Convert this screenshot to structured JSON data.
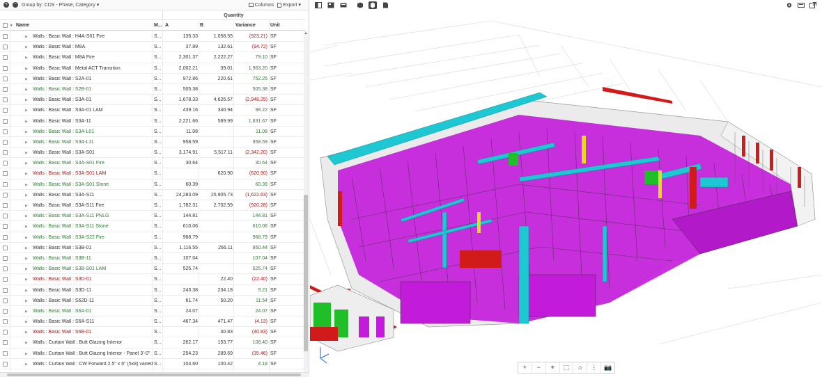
{
  "toolbar": {
    "group_by": "Group by: CDS - Phase, Category ▾",
    "columns": "Columns",
    "export": "Export ▾",
    "collapse_all": "+",
    "expand_all": "−"
  },
  "table": {
    "group_header": "Quantity",
    "headers": {
      "name": "Name",
      "m": "M...",
      "a": "A",
      "b": "B",
      "variance": "Variance",
      "unit": "Unit"
    },
    "rows": [
      {
        "name": "Walls : Basic Wall : H4A-S01 Fire",
        "m": "S...",
        "a": "135.33",
        "b": "1,058.55",
        "v": "(923.21)",
        "u": "SF",
        "nc": "c-black",
        "vc": "c-red"
      },
      {
        "name": "Walls : Basic Wall : M8A",
        "m": "S...",
        "a": "37.89",
        "b": "132.61",
        "v": "(94.72)",
        "u": "SF",
        "nc": "c-black",
        "vc": "c-red"
      },
      {
        "name": "Walls : Basic Wall : M8A Fire",
        "m": "S...",
        "a": "2,301.37",
        "b": "2,222.27",
        "v": "79.10",
        "u": "SF",
        "nc": "c-black",
        "vc": "c-green"
      },
      {
        "name": "Walls : Basic Wall : Metal ACT Transition",
        "m": "S...",
        "a": "2,002.21",
        "b": "39.01",
        "v": "1,963.20",
        "u": "SF",
        "nc": "c-black",
        "vc": "c-green"
      },
      {
        "name": "Walls : Basic Wall : S2A-01",
        "m": "S...",
        "a": "972.86",
        "b": "220.61",
        "v": "752.25",
        "u": "SF",
        "nc": "c-black",
        "vc": "c-green"
      },
      {
        "name": "Walls : Basic Wall : S2B-01",
        "m": "S...",
        "a": "505.38",
        "b": "",
        "v": "505.38",
        "u": "SF",
        "nc": "c-green",
        "vc": "c-green"
      },
      {
        "name": "Walls : Basic Wall : S3A-01",
        "m": "S...",
        "a": "1,678.33",
        "b": "4,626.57",
        "v": "(2,948.25)",
        "u": "SF",
        "nc": "c-black",
        "vc": "c-red"
      },
      {
        "name": "Walls : Basic Wall : S3A-01 LAM",
        "m": "S...",
        "a": "439.16",
        "b": "340.94",
        "v": "98.22",
        "u": "SF",
        "nc": "c-black",
        "vc": "c-green"
      },
      {
        "name": "Walls : Basic Wall : S3A-11",
        "m": "S...",
        "a": "2,221.66",
        "b": "589.99",
        "v": "1,631.67",
        "u": "SF",
        "nc": "c-black",
        "vc": "c-green"
      },
      {
        "name": "Walls : Basic Wall : S3A-L01",
        "m": "S...",
        "a": "11.08",
        "b": "",
        "v": "11.08",
        "u": "SF",
        "nc": "c-green",
        "vc": "c-green"
      },
      {
        "name": "Walls : Basic Wall : S3A-L11",
        "m": "S...",
        "a": "958.59",
        "b": "",
        "v": "958.59",
        "u": "SF",
        "nc": "c-green",
        "vc": "c-green"
      },
      {
        "name": "Walls : Basic Wall : S3A-S01",
        "m": "S...",
        "a": "3,174.91",
        "b": "5,517.11",
        "v": "(2,342.20)",
        "u": "SF",
        "nc": "c-black",
        "vc": "c-red"
      },
      {
        "name": "Walls : Basic Wall : S3A-S01 Fire",
        "m": "S...",
        "a": "30.64",
        "b": "",
        "v": "30.64",
        "u": "SF",
        "nc": "c-green",
        "vc": "c-green"
      },
      {
        "name": "Walls : Basic Wall : S3A-S01 LAM",
        "m": "S...",
        "a": "",
        "b": "620.90",
        "v": "(620.90)",
        "u": "SF",
        "nc": "c-red",
        "vc": "c-red"
      },
      {
        "name": "Walls : Basic Wall : S3A-S01 Stone",
        "m": "S...",
        "a": "60.39",
        "b": "",
        "v": "60.39",
        "u": "SF",
        "nc": "c-green",
        "vc": "c-green"
      },
      {
        "name": "Walls : Basic Wall : S3A-S11",
        "m": "S...",
        "a": "24,283.09",
        "b": "25,905.73",
        "v": "(1,622.63)",
        "u": "SF",
        "nc": "c-black",
        "vc": "c-red"
      },
      {
        "name": "Walls : Basic Wall : S3A-S11 Fire",
        "m": "S...",
        "a": "1,782.31",
        "b": "2,702.59",
        "v": "(920.28)",
        "u": "SF",
        "nc": "c-black",
        "vc": "c-red"
      },
      {
        "name": "Walls : Basic Wall : S3A-S11 PNLG",
        "m": "S...",
        "a": "144.81",
        "b": "",
        "v": "144.81",
        "u": "SF",
        "nc": "c-green",
        "vc": "c-green"
      },
      {
        "name": "Walls : Basic Wall : S3A-S11 Stone",
        "m": "S...",
        "a": "610.06",
        "b": "",
        "v": "610.06",
        "u": "SF",
        "nc": "c-green",
        "vc": "c-green"
      },
      {
        "name": "Walls : Basic Wall : S3A-S22 Fire",
        "m": "S...",
        "a": "968.79",
        "b": "",
        "v": "968.79",
        "u": "SF",
        "nc": "c-green",
        "vc": "c-green"
      },
      {
        "name": "Walls : Basic Wall : S3B-01",
        "m": "S...",
        "a": "1,116.55",
        "b": "266.11",
        "v": "850.44",
        "u": "SF",
        "nc": "c-black",
        "vc": "c-green"
      },
      {
        "name": "Walls : Basic Wall : S3B-11",
        "m": "S...",
        "a": "107.04",
        "b": "",
        "v": "107.04",
        "u": "SF",
        "nc": "c-green",
        "vc": "c-green"
      },
      {
        "name": "Walls : Basic Wall : S3B-S01 LAM",
        "m": "S...",
        "a": "525.74",
        "b": "",
        "v": "525.74",
        "u": "SF",
        "nc": "c-green",
        "vc": "c-green"
      },
      {
        "name": "Walls : Basic Wall : S3D-01",
        "m": "S...",
        "a": "",
        "b": "22.40",
        "v": "(22.40)",
        "u": "SF",
        "nc": "c-red",
        "vc": "c-red"
      },
      {
        "name": "Walls : Basic Wall : S3D-11",
        "m": "S...",
        "a": "243.38",
        "b": "234.18",
        "v": "9.21",
        "u": "SF",
        "nc": "c-black",
        "vc": "c-green"
      },
      {
        "name": "Walls : Basic Wall : S62D-11",
        "m": "S...",
        "a": "61.74",
        "b": "50.20",
        "v": "11.54",
        "u": "SF",
        "nc": "c-black",
        "vc": "c-green"
      },
      {
        "name": "Walls : Basic Wall : S6A-01",
        "m": "S...",
        "a": "24.07",
        "b": "",
        "v": "24.07",
        "u": "SF",
        "nc": "c-green",
        "vc": "c-green"
      },
      {
        "name": "Walls : Basic Wall : S6A-S11",
        "m": "S...",
        "a": "467.34",
        "b": "471.47",
        "v": "(4.13)",
        "u": "SF",
        "nc": "c-black",
        "vc": "c-red"
      },
      {
        "name": "Walls : Basic Wall : S6B-01",
        "m": "S...",
        "a": "",
        "b": "40.83",
        "v": "(40.83)",
        "u": "SF",
        "nc": "c-red",
        "vc": "c-red"
      },
      {
        "name": "Walls : Curtain Wall : Butt Glazing Interior",
        "m": "S...",
        "a": "262.17",
        "b": "153.77",
        "v": "108.40",
        "u": "SF",
        "nc": "c-black",
        "vc": "c-green"
      },
      {
        "name": "Walls : Curtain Wall : Butt Glazing Interior - Panel 3'-0\"",
        "m": "S...",
        "a": "254.23",
        "b": "289.69",
        "v": "(35.46)",
        "u": "SF",
        "nc": "c-black",
        "vc": "c-red"
      },
      {
        "name": "Walls : Curtain Wall : CW Forward 2.5\" x 6\" (5x8) varied",
        "m": "S...",
        "a": "104.60",
        "b": "100.42",
        "v": "4.18",
        "u": "SF",
        "nc": "c-black",
        "vc": "c-green"
      }
    ]
  },
  "viewer": {
    "bottom_tools": [
      "+",
      "−",
      "⌖",
      "⬚",
      "⌂",
      "⋮",
      "📷"
    ],
    "colors": {
      "magenta": "#c21bd9",
      "cyan": "#1ec8d2",
      "red": "#d11a1a",
      "green": "#1fbf2a",
      "yellow": "#e6dc1a"
    }
  }
}
